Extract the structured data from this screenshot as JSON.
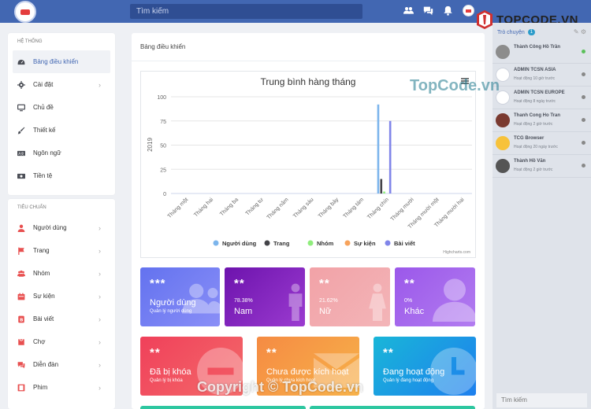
{
  "header": {
    "search_placeholder": "Tìm kiếm",
    "icons": [
      "users-icon",
      "messages-icon",
      "bell-icon",
      "avatar"
    ]
  },
  "sidebar": {
    "section1_title": "Hệ thống",
    "section1": [
      {
        "label": "Bảng điều khiển",
        "icon": "dashboard-icon",
        "active": true
      },
      {
        "label": "Cài đặt",
        "icon": "gear-icon",
        "chevron": true
      },
      {
        "label": "Chủ đề",
        "icon": "monitor-icon"
      },
      {
        "label": "Thiết kế",
        "icon": "brush-icon"
      },
      {
        "label": "Ngôn ngữ",
        "icon": "language-icon"
      },
      {
        "label": "Tiền tệ",
        "icon": "money-icon"
      }
    ],
    "section2_title": "Tiêu chuẩn",
    "section2": [
      {
        "label": "Người dùng",
        "icon": "user-icon"
      },
      {
        "label": "Trang",
        "icon": "flag-icon"
      },
      {
        "label": "Nhóm",
        "icon": "group-icon"
      },
      {
        "label": "Sự kiện",
        "icon": "calendar-icon"
      },
      {
        "label": "Bài viết",
        "icon": "article-icon"
      },
      {
        "label": "Chợ",
        "icon": "cart-icon"
      },
      {
        "label": "Diễn đàn",
        "icon": "forum-icon"
      },
      {
        "label": "Phim",
        "icon": "film-icon"
      }
    ]
  },
  "main": {
    "breadcrumb": "Bảng điều khiển",
    "credit": "Highcharts.com",
    "stats": [
      {
        "stars": "***",
        "title": "Người dùng",
        "sub": "Quản lý người dùng",
        "color": "#6f7df0"
      },
      {
        "stars": "**",
        "pct": "78.38%",
        "title": "Nam",
        "color": "#7a1fb0"
      },
      {
        "stars": "**",
        "pct": "21.62%",
        "title": "Nữ",
        "color": "#f0a0a8"
      },
      {
        "stars": "**",
        "pct": "0%",
        "title": "Khác",
        "color": "#a063e8"
      },
      {
        "stars": "**",
        "title": "Đã bị khóa",
        "sub": "Quản lý bị khóa",
        "color": "#f0405a"
      },
      {
        "stars": "**",
        "title": "Chưa được kích hoạt",
        "sub": "Quản lý chưa kích hoạt",
        "color": "#f7a040"
      },
      {
        "stars": "**",
        "title": "Đang hoạt động",
        "sub": "Quản lý đang hoạt động",
        "color": "#1e90e8"
      }
    ]
  },
  "chart_data": {
    "type": "bar",
    "title": "Trung bình hàng tháng",
    "ylabel": "2019",
    "ylim": [
      0,
      100
    ],
    "yticks": [
      0,
      25,
      50,
      75,
      100
    ],
    "categories": [
      "Tháng một",
      "Tháng hai",
      "Tháng ba",
      "Tháng tư",
      "Tháng năm",
      "Tháng sáu",
      "Tháng bảy",
      "Tháng tám",
      "Tháng chín",
      "Tháng mười",
      "Tháng mười một",
      "Tháng mười hai"
    ],
    "series": [
      {
        "name": "Người dùng",
        "color": "#7cb5ec",
        "values": [
          0,
          0,
          0,
          0,
          0,
          0,
          0,
          0,
          92,
          0,
          0,
          0
        ]
      },
      {
        "name": "Trang",
        "color": "#434348",
        "values": [
          0,
          0,
          0,
          0,
          0,
          0,
          0,
          0,
          15,
          0,
          0,
          0
        ]
      },
      {
        "name": "Nhóm",
        "color": "#90ed7d",
        "values": [
          0,
          0,
          0,
          0,
          0,
          0,
          0,
          0,
          2,
          0,
          0,
          0
        ]
      },
      {
        "name": "Sự kiện",
        "color": "#f7a35c",
        "values": [
          0,
          0,
          0,
          0,
          0,
          0,
          0,
          0,
          0,
          0,
          0,
          0
        ]
      },
      {
        "name": "Bài viết",
        "color": "#8085e9",
        "values": [
          0,
          0,
          0,
          0,
          0,
          0,
          0,
          0,
          75,
          0,
          0,
          0
        ]
      }
    ],
    "grid": true,
    "legend": "bottom"
  },
  "chat": {
    "title": "Trò chuyện",
    "count": "1",
    "search_placeholder": "Tìm kiếm",
    "users": [
      {
        "name": "Thành Công Hồ Trần",
        "status": "",
        "online": true
      },
      {
        "name": "ADMIN TCSN ASIA",
        "status": "Hoạt động 10 giờ trước",
        "online": false
      },
      {
        "name": "ADMIN TCSN EUROPE",
        "status": "Hoạt động 8 ngày trước",
        "online": false
      },
      {
        "name": "Thanh Cong Ho Tran",
        "status": "Hoạt động 2 giờ trước",
        "online": false
      },
      {
        "name": "TCG Browser",
        "status": "Hoạt động 20 ngày trước",
        "online": false
      },
      {
        "name": "Thành Hồ Văn",
        "status": "Hoạt động 2 giờ trước",
        "online": false
      }
    ]
  },
  "watermark": {
    "brand": "TOPCODE.VN",
    "mid": "TopCode.vn",
    "copyright": "Copyright © TopCode.vn"
  }
}
